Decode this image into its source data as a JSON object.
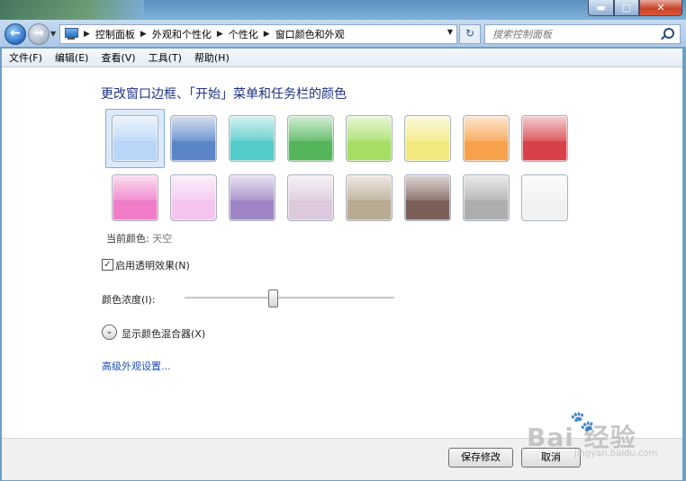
{
  "window": {
    "min_glyph": "▬",
    "max_glyph": "□",
    "close_glyph": "✕"
  },
  "address": {
    "crumbs": [
      "控制面板",
      "外观和个性化",
      "个性化",
      "窗口颜色和外观"
    ],
    "search_placeholder": "搜索控制面板"
  },
  "menu": [
    "文件(F)",
    "编辑(E)",
    "查看(V)",
    "工具(T)",
    "帮助(H)"
  ],
  "page": {
    "heading": "更改窗口边框、「开始」菜单和任务栏的颜色",
    "swatches_row1": [
      {
        "name": "sky",
        "color": "#b8d6f7"
      },
      {
        "name": "twilight",
        "color": "#5a86c9"
      },
      {
        "name": "sea",
        "color": "#52cbc9"
      },
      {
        "name": "leaf",
        "color": "#53b55a"
      },
      {
        "name": "lime",
        "color": "#a6de63"
      },
      {
        "name": "lemon",
        "color": "#f2ea7e"
      },
      {
        "name": "orange",
        "color": "#f7a24a"
      },
      {
        "name": "red",
        "color": "#d9414a"
      }
    ],
    "swatches_row2": [
      {
        "name": "fuchsia",
        "color": "#f07bc7"
      },
      {
        "name": "blush",
        "color": "#f4c4ee"
      },
      {
        "name": "violet",
        "color": "#9f85c6"
      },
      {
        "name": "lavender",
        "color": "#dcc9dd"
      },
      {
        "name": "taupe",
        "color": "#b8ab92"
      },
      {
        "name": "chocolate",
        "color": "#7c5f58"
      },
      {
        "name": "slate",
        "color": "#aeaeae"
      },
      {
        "name": "frost",
        "color": "#f1f1f1"
      }
    ],
    "selected_index": 0,
    "current_color_label": "当前颜色:",
    "current_color_value": "天空",
    "transparency_checked_glyph": "✓",
    "transparency_label": "启用透明效果(N)",
    "intensity_label": "颜色浓度(I):",
    "intensity_value": 0.42,
    "mixer_glyph": "⌄",
    "mixer_label": "显示颜色混合器(X)",
    "advanced_link": "高级外观设置..."
  },
  "buttons": {
    "save": "保存修改",
    "cancel": "取消"
  },
  "watermark": {
    "main": "Bai  经验",
    "paw": "🐾",
    "sub": "jingyan.baidu.com"
  }
}
